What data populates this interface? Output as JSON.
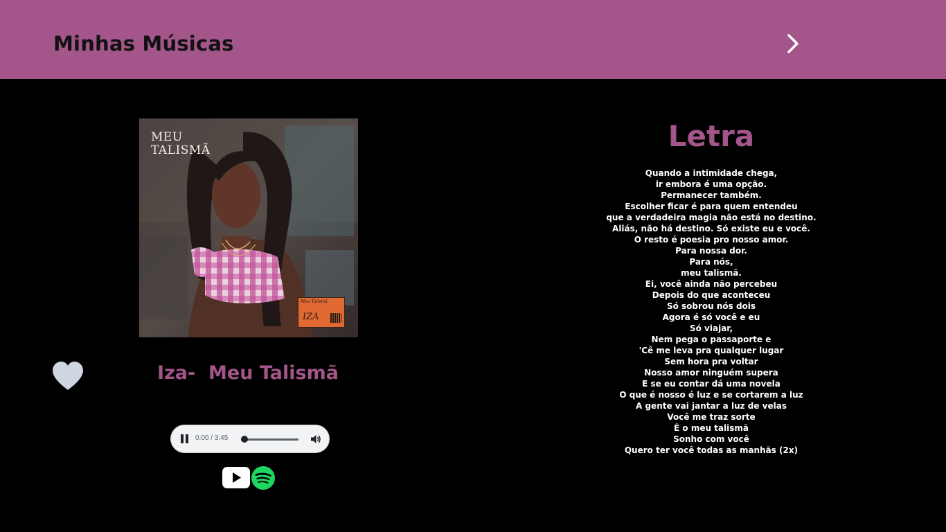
{
  "header": {
    "title": "Minhas Músicas",
    "next_icon": "chevron-right-icon",
    "background_color": "#a45589"
  },
  "album": {
    "cover_title_line1": "MEU",
    "cover_title_line2": "TALISMÃ",
    "sticker_title": "Meu Talismã",
    "sticker_artist": "IZA"
  },
  "favorite": {
    "icon": "heart-icon",
    "color": "#cfd6e2"
  },
  "song": {
    "title": "Iza-  Meu Talismã",
    "color": "#a45589"
  },
  "player": {
    "state": "playing",
    "time": "0:00 / 3:45",
    "progress": 0,
    "play_pause_icon": "pause-icon",
    "volume_icon": "volume-icon"
  },
  "links": {
    "youtube_icon": "youtube-icon",
    "spotify_icon": "spotify-icon"
  },
  "lyrics": {
    "heading": "Letra",
    "lines": [
      "Quando a intimidade chega,",
      "ir embora é uma opção.",
      "Permanecer também.",
      "Escolher ficar é para quem entendeu",
      "que a verdadeira magia não está no destino.",
      "Aliás, não há destino. Só existe eu e você.",
      "O resto é poesia pro nosso amor.",
      "Para nossa dor.",
      "Para nós,",
      "meu talismã.",
      "Ei, você ainda não percebeu",
      "Depois do que aconteceu",
      "Só sobrou nós dois",
      "Agora é só você e eu",
      "Só viajar,",
      "Nem pega o passaporte e",
      "'Cê me leva pra qualquer lugar",
      "Sem hora pra voltar",
      "Nosso amor ninguém supera",
      "E se eu contar dá uma novela",
      "O que é nosso é luz e se cortarem a luz",
      "A gente vai jantar a luz de velas",
      "Você me traz sorte",
      "É o meu talismã",
      "Sonho com você",
      "Quero ter você todas as manhãs (2x)"
    ]
  }
}
